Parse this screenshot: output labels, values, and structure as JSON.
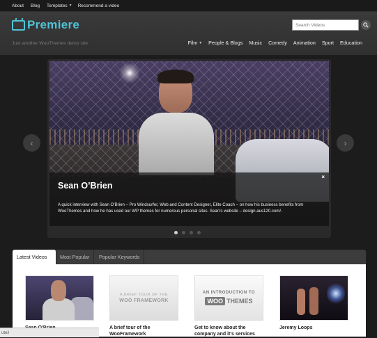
{
  "topnav": {
    "items": [
      "About",
      "Blog",
      "Templates",
      "Recommend a video"
    ]
  },
  "header": {
    "logo_text": "Premiere",
    "tagline": "Just another WooThemes demo site",
    "search_placeholder": "Search Videos",
    "nav": [
      "Film",
      "People & Blogs",
      "Music",
      "Comedy",
      "Animation",
      "Sport",
      "Education"
    ]
  },
  "featured": {
    "title": "Sean O’Brien",
    "description": "A quick interview with Sean O’Brien – Pro Windsurfer, Web and Content Designer, Elite Coach – on how his business benefits from WooThemes and how he has used our WP themes for numerous personal sites. Sean’s website – design.aus120.com/.",
    "close": "×",
    "prev": "‹",
    "next": "›",
    "slides_total": 4,
    "active_slide": 1
  },
  "tabs": {
    "items": [
      "Latest Videos",
      "Most Popular",
      "Popular Keywords"
    ],
    "active": 0
  },
  "videos": [
    {
      "title": "Sean O'Brien"
    },
    {
      "title": "A brief tour of the WooFramework",
      "thumb_line1": "A BRIEF TOUR OF THE",
      "thumb_line2": "WOO FRAMEWORK"
    },
    {
      "title": "Get to know about the company and it's services",
      "thumb_line1": "AN INTRODUCTION TO",
      "thumb_woo": "WOO",
      "thumb_themes": "THEMES"
    },
    {
      "title": "Jeremy Loops"
    }
  ],
  "statusbar": {
    "text": "ute/i"
  },
  "colors": {
    "accent": "#4fc3d6",
    "background": "#1c1c1c"
  }
}
